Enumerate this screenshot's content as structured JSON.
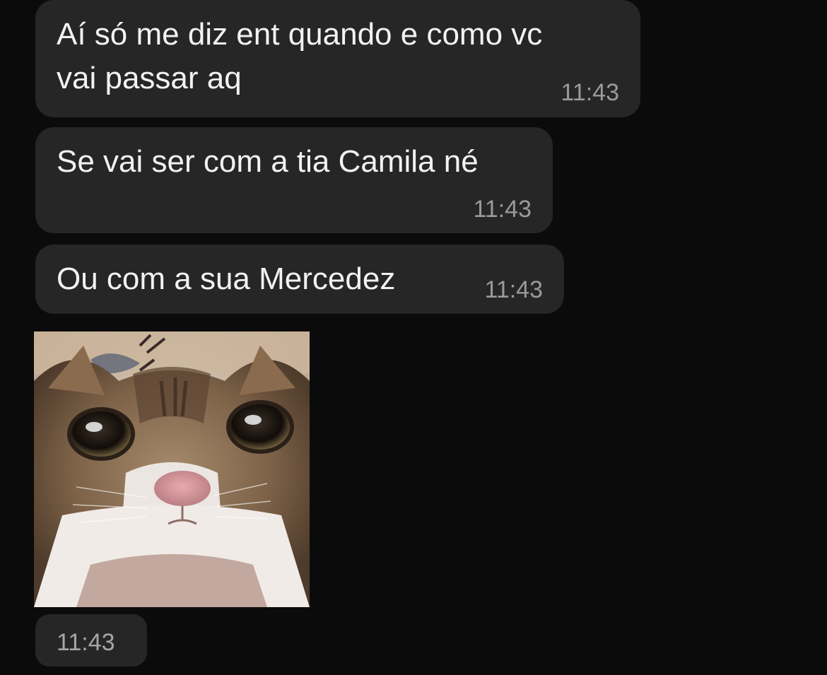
{
  "chat": {
    "messages": [
      {
        "lines": [
          "Aí só me diz ent quando e como vc",
          "vai passar aq"
        ],
        "time": "11:43"
      },
      {
        "lines": [
          "Se vai ser com a tia Camila né"
        ],
        "time": "11:43"
      },
      {
        "lines": [
          "Ou com a sua Mercedez"
        ],
        "time": "11:43"
      },
      {
        "image": "cat-photo",
        "time": "11:43"
      }
    ]
  },
  "colors": {
    "background": "#0b0b0b",
    "bubble": "#262626",
    "text": "#f2f2f2",
    "timestamp": "#9a9a9a"
  }
}
